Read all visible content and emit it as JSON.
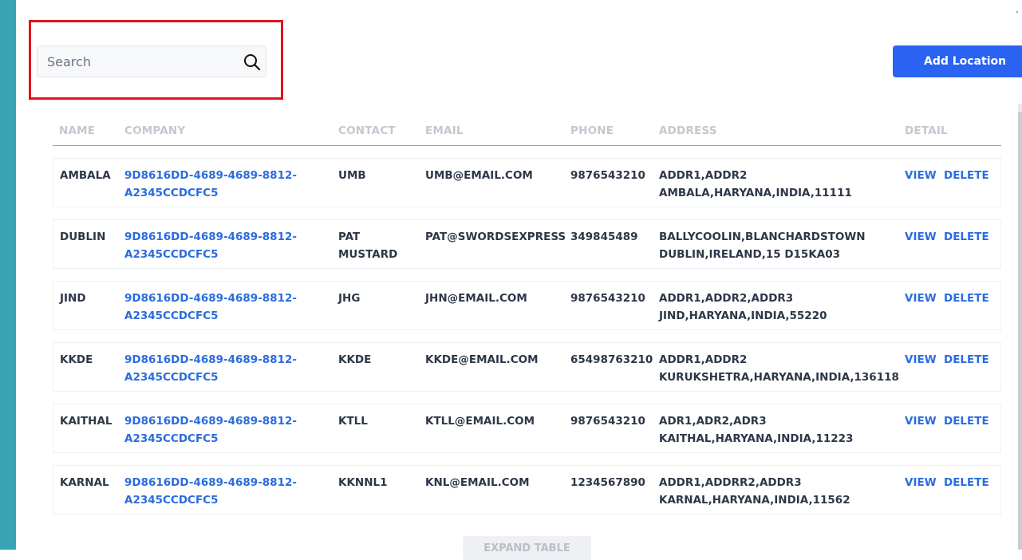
{
  "search": {
    "placeholder": "Search",
    "value": ""
  },
  "toolbar": {
    "add_label": "Add Location"
  },
  "table": {
    "headers": [
      "NAME",
      "COMPANY",
      "CONTACT",
      "EMAIL",
      "PHONE",
      "ADDRESS",
      "DETAIL"
    ],
    "rows": [
      {
        "name": "AMBALA",
        "company_line1": "9D8616DD-4689-4689-8812-",
        "company_line2": "A2345CCDCFC5",
        "contact_line1": "UMB",
        "contact_line2": "",
        "email": "UMB@EMAIL.COM",
        "phone": "9876543210",
        "address_line1": "ADDR1,ADDR2",
        "address_line2": "AMBALA,HARYANA,INDIA,11111"
      },
      {
        "name": "DUBLIN",
        "company_line1": "9D8616DD-4689-4689-8812-",
        "company_line2": "A2345CCDCFC5",
        "contact_line1": "PAT",
        "contact_line2": "MUSTARD",
        "email": "PAT@SWORDSEXPRESS",
        "phone": "349845489",
        "address_line1": "BALLYCOOLIN,BLANCHARDSTOWN",
        "address_line2": "DUBLIN,IRELAND,15 D15KA03"
      },
      {
        "name": "JIND",
        "company_line1": "9D8616DD-4689-4689-8812-",
        "company_line2": "A2345CCDCFC5",
        "contact_line1": "JHG",
        "contact_line2": "",
        "email": "JHN@EMAIL.COM",
        "phone": "9876543210",
        "address_line1": "ADDR1,ADDR2,ADDR3",
        "address_line2": "JIND,HARYANA,INDIA,55220"
      },
      {
        "name": "KKDE",
        "company_line1": "9D8616DD-4689-4689-8812-",
        "company_line2": "A2345CCDCFC5",
        "contact_line1": "KKDE",
        "contact_line2": "",
        "email": "KKDE@EMAIL.COM",
        "phone": "65498763210",
        "address_line1": "ADDR1,ADDR2",
        "address_line2": "KURUKSHETRA,HARYANA,INDIA,136118"
      },
      {
        "name": "KAITHAL",
        "company_line1": "9D8616DD-4689-4689-8812-",
        "company_line2": "A2345CCDCFC5",
        "contact_line1": "KTLL",
        "contact_line2": "",
        "email": "KTLL@EMAIL.COM",
        "phone": "9876543210",
        "address_line1": "ADR1,ADR2,ADR3",
        "address_line2": "KAITHAL,HARYANA,INDIA,11223"
      },
      {
        "name": "KARNAL",
        "company_line1": "9D8616DD-4689-4689-8812-",
        "company_line2": "A2345CCDCFC5",
        "contact_line1": "KKNNL1",
        "contact_line2": "",
        "email": "KNL@EMAIL.COM",
        "phone": "1234567890",
        "address_line1": "ADDR1,ADDRR2,ADDR3",
        "address_line2": "KARNAL,HARYANA,INDIA,11562"
      }
    ],
    "actions": {
      "view_label": "VIEW",
      "delete_label": "DELETE"
    }
  },
  "footer": {
    "expand_label": "EXPAND TABLE"
  },
  "colors": {
    "accent": "#2a63f2",
    "link": "#2b6cde",
    "sidebar": "#38a3b4",
    "highlight": "#e0131a"
  },
  "icons": {
    "search": "search-icon"
  }
}
